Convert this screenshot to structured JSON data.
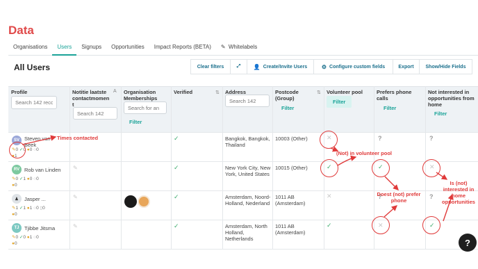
{
  "page": {
    "title": "Data"
  },
  "nav": {
    "tabs": [
      {
        "label": "Organisations"
      },
      {
        "label": "Users"
      },
      {
        "label": "Signups"
      },
      {
        "label": "Opportunities"
      },
      {
        "label": "Impact Reports (BETA)"
      },
      {
        "label": "Whitelabels"
      }
    ]
  },
  "section": {
    "title": "All Users"
  },
  "toolbar": {
    "clear_filters": "Clear filters",
    "create_invite": "Create/Invite Users",
    "configure": "Configure custom fields",
    "export": "Export",
    "show_hide": "Show/Hide Fields"
  },
  "table": {
    "headers": {
      "profile": "Profile",
      "notitie": "Notitie laatste contactmomen t",
      "org": "Organisation Memberships",
      "verified": "Verified",
      "address": "Address",
      "postcode": "Postcode (Group)",
      "volunteer": "Volunteer pool",
      "phone": "Prefers phone calls",
      "home": "Not interested in opportunities from home"
    },
    "placeholders": {
      "profile": "Search 142 reco",
      "notitie": "Search 142",
      "org": "Search for an",
      "address": "Search 142"
    },
    "filter_label": "Filter",
    "sort_az": "A",
    "rows": [
      {
        "initials": "SV",
        "name": "Steven van Beek",
        "stats": [
          "0",
          "0",
          "0",
          "0",
          "1"
        ],
        "address": "Bangkok, Bangkok, Thailand",
        "postcode": "10003 (Other)"
      },
      {
        "initials": "RV",
        "name": "Rob van Linden",
        "stats": [
          "0",
          "1",
          "0",
          "0",
          "0"
        ],
        "address": "New York City, New York, United States",
        "postcode": "10015 (Other)"
      },
      {
        "initials": "",
        "name": "Jasper ...",
        "stats": [
          "1",
          "1",
          "1",
          "0",
          "0"
        ],
        "address": "Amsterdam, Noord-Holland, Nederland",
        "postcode": "1011 AB (Amsterdam)"
      },
      {
        "initials": "TJ",
        "name": "Tjibbe Jitsma",
        "stats": [
          "0",
          "0",
          "1",
          "0",
          "0"
        ],
        "address": "Amsterdam, North Holland, Netherlands",
        "postcode": "1011 AB (Amsterdam)"
      }
    ]
  },
  "annotations": {
    "times_contacted": "Times contacted",
    "volunteer_pool": "(Not) in volunteer pool",
    "prefer_phone": "Doest (not) prefer phone",
    "home_opps": "Is (not) interested in home opportunities"
  },
  "help": {
    "label": "?"
  },
  "colors": {
    "accent": "#1aa398",
    "title": "#e04a4a",
    "annotation": "#e03a3a",
    "link": "#1a6f8c"
  }
}
